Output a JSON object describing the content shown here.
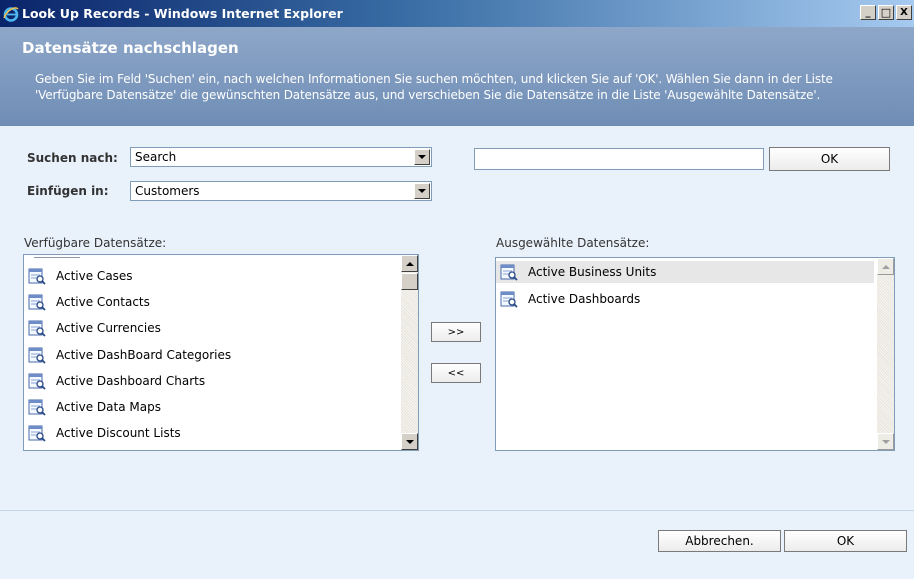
{
  "window": {
    "title": "Look Up Records - Windows Internet Explorer",
    "minimize_glyph": "_",
    "maximize_glyph": "□",
    "close_glyph": "X"
  },
  "header": {
    "title": "Datensätze nachschlagen",
    "description": "Geben Sie im Feld 'Suchen' ein, nach welchen Informationen Sie suchen möchten, und klicken Sie auf 'OK'. Wählen Sie dann in der Liste 'Verfügbare Datensätze' die gewünschten Datensätze aus, und verschieben Sie die Datensätze in die Liste 'Ausgewählte Datensätze'."
  },
  "search": {
    "search_for_label": "Suchen nach:",
    "search_for_value": "Search",
    "insert_in_label": "Einfügen in:",
    "insert_in_value": "Customers",
    "search_text": "",
    "ok_label": "OK"
  },
  "available": {
    "label": "Verfügbare Datensätze:",
    "items": [
      {
        "label": "Active Cases",
        "icon": "record-icon"
      },
      {
        "label": "Active Contacts",
        "icon": "record-icon"
      },
      {
        "label": "Active Currencies",
        "icon": "record-icon"
      },
      {
        "label": "Active DashBoard Categories",
        "icon": "record-icon"
      },
      {
        "label": "Active Dashboard Charts",
        "icon": "record-icon"
      },
      {
        "label": "Active Data Maps",
        "icon": "record-icon"
      },
      {
        "label": "Active Discount Lists",
        "icon": "record-icon"
      }
    ]
  },
  "move": {
    "add_label": ">>",
    "remove_label": "<<"
  },
  "selected": {
    "label": "Ausgewählte Datensätze:",
    "items": [
      {
        "label": "Active Business Units",
        "icon": "record-icon",
        "selected": true
      },
      {
        "label": "Active Dashboards",
        "icon": "record-icon",
        "selected": false
      }
    ]
  },
  "footer": {
    "cancel_label": "Abbrechen.",
    "ok_label": "OK"
  },
  "colors": {
    "header_bg": "#7592b9",
    "body_bg": "#e9f1fb",
    "titlebar_start": "#0a246a",
    "titlebar_end": "#a6caf0"
  }
}
